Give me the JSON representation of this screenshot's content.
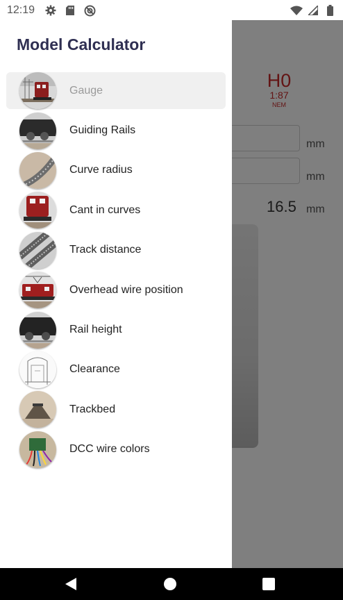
{
  "status_bar": {
    "time": "12:19",
    "left_icons": [
      "gear-icon",
      "sd-card-icon",
      "sync-icon"
    ],
    "right_icons": [
      "wifi-icon",
      "signal-icon",
      "battery-icon"
    ]
  },
  "background": {
    "gauge_name": "H0",
    "gauge_scale": "1:87",
    "gauge_standard": "NEM",
    "unit_1": "mm",
    "unit_2": "mm",
    "value": "16.5",
    "value_unit": "mm"
  },
  "drawer": {
    "title": "Model Calculator",
    "items": [
      {
        "label": "Gauge",
        "selected": true
      },
      {
        "label": "Guiding Rails",
        "selected": false
      },
      {
        "label": "Curve radius",
        "selected": false
      },
      {
        "label": "Cant in curves",
        "selected": false
      },
      {
        "label": "Track distance",
        "selected": false
      },
      {
        "label": "Overhead wire position",
        "selected": false
      },
      {
        "label": "Rail height",
        "selected": false
      },
      {
        "label": "Clearance",
        "selected": false
      },
      {
        "label": "Trackbed",
        "selected": false
      },
      {
        "label": "DCC wire colors",
        "selected": false
      }
    ]
  },
  "nav_bar": {
    "buttons": [
      "back-icon",
      "home-icon",
      "recents-icon"
    ]
  },
  "colors": {
    "accent": "#c62828",
    "title": "#2f2f52",
    "scrim": "rgba(0,0,0,0.5)"
  }
}
